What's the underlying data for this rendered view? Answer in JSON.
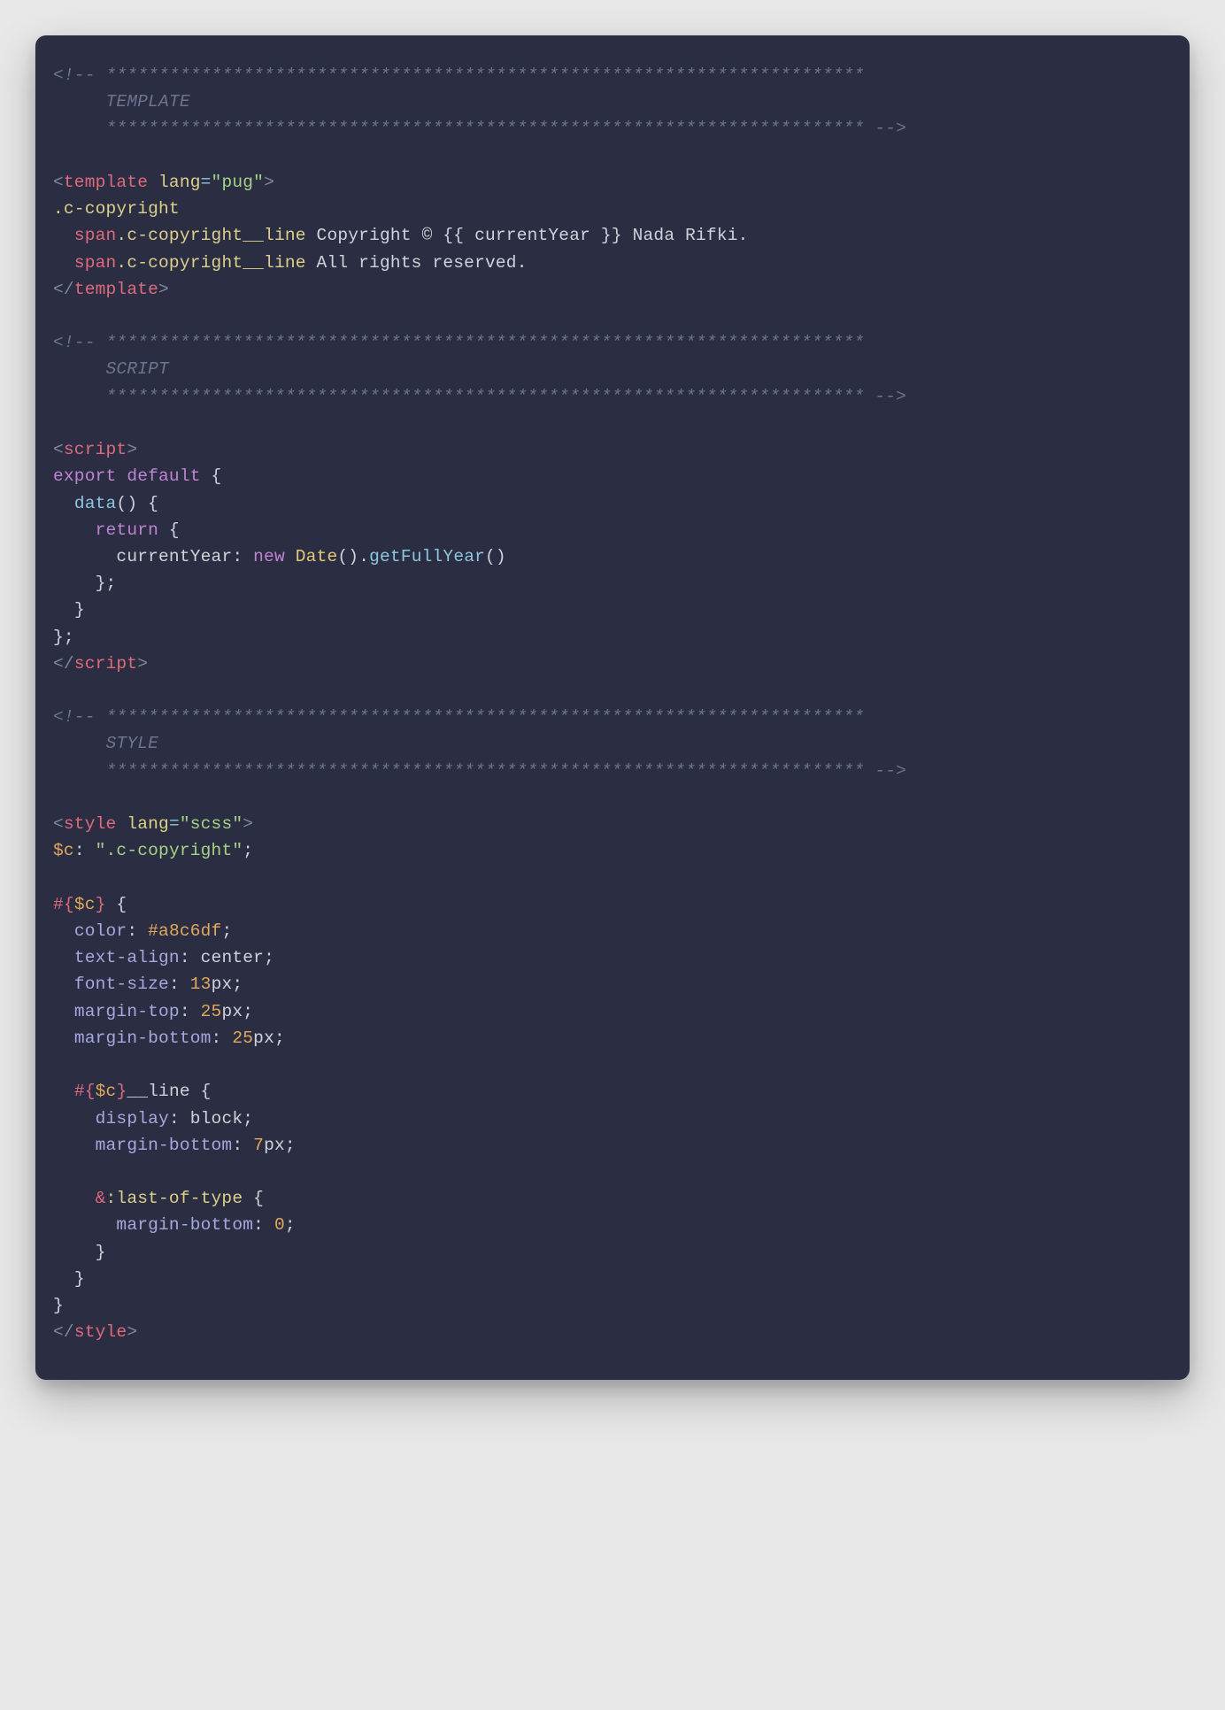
{
  "code": {
    "commentStars": "************************************************************************",
    "sectionTemplate": "TEMPLATE",
    "sectionScript": "SCRIPT",
    "sectionStyle": "STYLE",
    "templateOpen1": "<",
    "templateOpen2": "template",
    "templateOpen3": " lang",
    "templateOpen4": "=",
    "templateOpen5": "\"pug\"",
    "templateOpen6": ">",
    "pug1": ".c-copyright",
    "pug2a": "span",
    "pug2b": ".c-copyright__line",
    "pug2c": " Copyright © {{ currentYear }} Nada Rifki.",
    "pug3a": "span",
    "pug3b": ".c-copyright__line",
    "pug3c": " All rights reserved.",
    "templateClose1": "</",
    "templateClose2": "template",
    "templateClose3": ">",
    "scriptOpen1": "<",
    "scriptOpen2": "script",
    "scriptOpen3": ">",
    "js1a": "export",
    "js1b": " ",
    "js1c": "default",
    "js1d": " {",
    "js2a": "data",
    "js2b": "()",
    "js2c": " {",
    "js3a": "return",
    "js3b": " {",
    "js4a": "currentYear",
    "js4b": ": ",
    "js4c": "new",
    "js4d": " ",
    "js4e": "Date",
    "js4f": "()",
    "js4g": ".",
    "js4h": "getFullYear",
    "js4i": "()",
    "js5": "};",
    "js6": "}",
    "js7": "};",
    "scriptClose1": "</",
    "scriptClose2": "script",
    "scriptClose3": ">",
    "styleOpen1": "<",
    "styleOpen2": "style",
    "styleOpen3": " lang",
    "styleOpen4": "=",
    "styleOpen5": "\"scss\"",
    "styleOpen6": ">",
    "scss1a": "$c",
    "scss1b": ": ",
    "scss1c": "\".c-copyright\"",
    "scss1d": ";",
    "scss2a": "#{",
    "scss2b": "$c",
    "scss2c": "}",
    "scss2d": " {",
    "scss3a": "color",
    "scss3b": ": ",
    "scss3c": "#a8c6df",
    "scss3d": ";",
    "scss4a": "text-align",
    "scss4b": ": ",
    "scss4c": "center",
    "scss4d": ";",
    "scss5a": "font-size",
    "scss5b": ": ",
    "scss5c": "13",
    "scss5d": "px",
    "scss5e": ";",
    "scss6a": "margin-top",
    "scss6b": ": ",
    "scss6c": "25",
    "scss6d": "px",
    "scss6e": ";",
    "scss7a": "margin-bottom",
    "scss7b": ": ",
    "scss7c": "25",
    "scss7d": "px",
    "scss7e": ";",
    "scss8a": "#{",
    "scss8b": "$c",
    "scss8c": "}",
    "scss8d": "__line",
    "scss8e": " {",
    "scss9a": "display",
    "scss9b": ": ",
    "scss9c": "block",
    "scss9d": ";",
    "scss10a": "margin-bottom",
    "scss10b": ": ",
    "scss10c": "7",
    "scss10d": "px",
    "scss10e": ";",
    "scss11a": "&",
    "scss11b": ":last-of-type",
    "scss11c": " {",
    "scss12a": "margin-bottom",
    "scss12b": ": ",
    "scss12c": "0",
    "scss12d": ";",
    "scss13": "}",
    "scss14": "}",
    "scss15": "}",
    "styleClose1": "</",
    "styleClose2": "style",
    "styleClose3": ">"
  }
}
